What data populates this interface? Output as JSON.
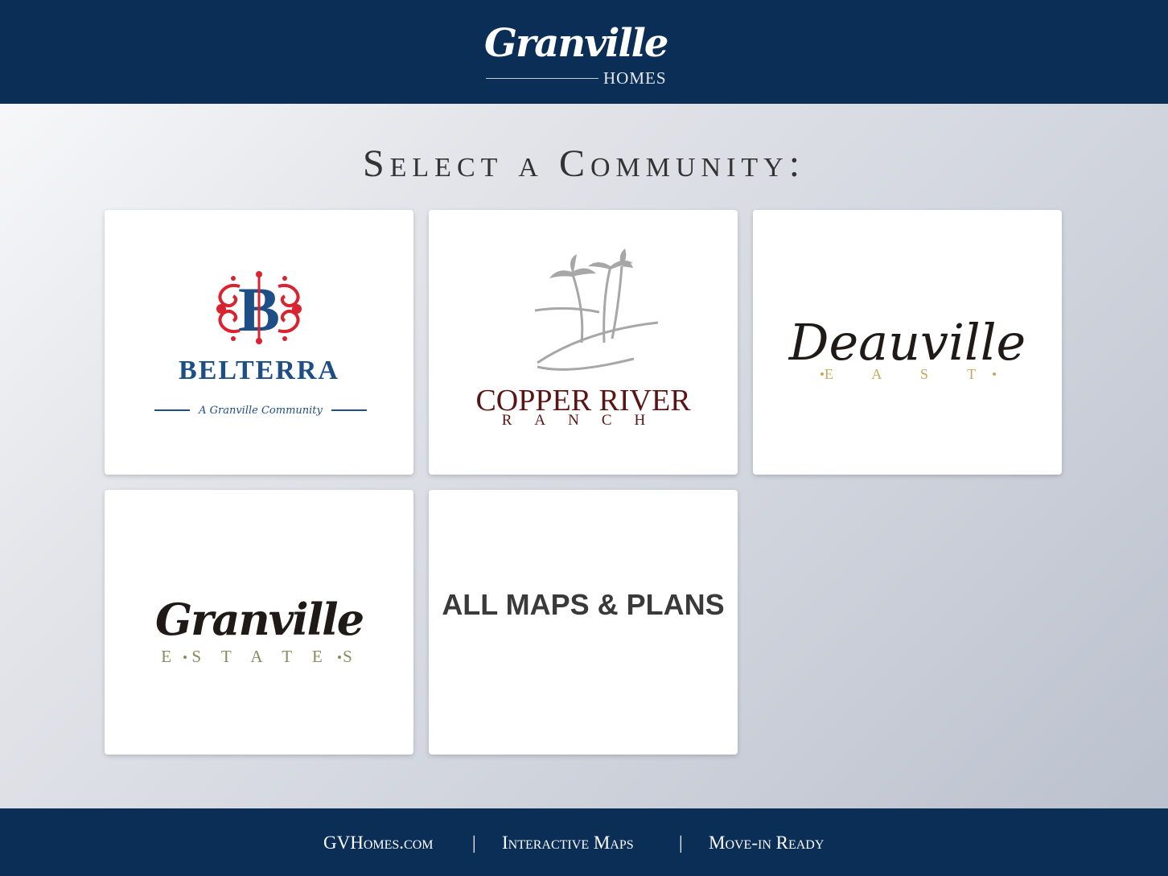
{
  "header": {
    "logo": {
      "name": "Granville",
      "sub": "HOMES"
    }
  },
  "page": {
    "title": "Select a Community:"
  },
  "communities": [
    {
      "icon": "belterra-logo",
      "name": "BELTERRA",
      "tagline": "A Granville Community",
      "color_primary": "#1d4f86",
      "color_accent": "#d9232e"
    },
    {
      "icon": "copper-river-ranch-logo",
      "name": "COPPER RIVER",
      "sub": "RANCH",
      "color_primary": "#5a1414",
      "color_accent": "#a7a7a7"
    },
    {
      "icon": "deauville-east-logo",
      "name": "Deauville",
      "sub": "E A S T",
      "color_primary": "#1f1a17",
      "color_accent": "#c9a65b"
    },
    {
      "icon": "granville-estates-logo",
      "name": "Granville",
      "sub": "E S T A T E S",
      "color_primary": "#1f1a17",
      "color_accent": "#8a8a5c"
    },
    {
      "name": "ALL MAPS & PLANS"
    }
  ],
  "footer": {
    "links": [
      "GVHomes.com",
      "Interactive Maps",
      "Move-in Ready"
    ],
    "separator": "|"
  },
  "colors": {
    "navy": "#0b2e57",
    "card_bg": "#ffffff",
    "title_text": "#333333"
  }
}
